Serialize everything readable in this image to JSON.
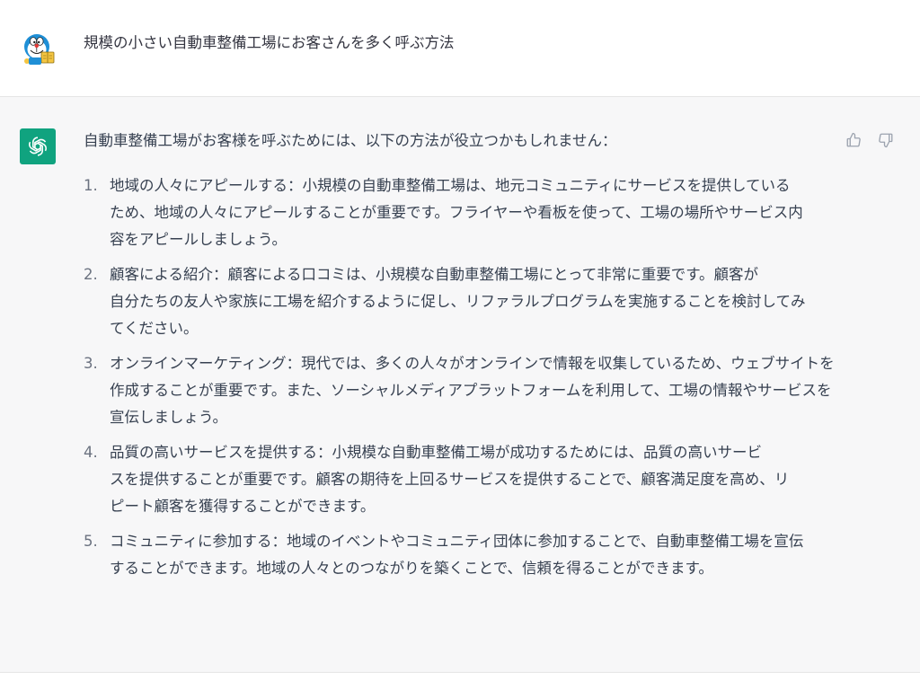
{
  "user_message": {
    "text": "規模の小さい自動車整備工場にお客さんを多く呼ぶ方法"
  },
  "assistant_message": {
    "intro": "自動車整備工場がお客様を呼ぶためには、以下の方法が役立つかもしれません：",
    "items": [
      {
        "number": "1.",
        "lines": [
          "地域の人々にアピールする：小規模の自動車整備工場は、地元コミュニティにサービスを提供している",
          "ため、地域の人々にアピールすることが重要です。フライヤーや看板を使って、工場の場所やサービス内",
          "容をアピールしましょう。"
        ]
      },
      {
        "number": "2.",
        "lines": [
          "顧客による紹介：顧客による口コミは、小規模な自動車整備工場にとって非常に重要です。顧客が",
          "自分たちの友人や家族に工場を紹介するように促し、リファラルプログラムを実施することを検討してみ",
          "てください。"
        ]
      },
      {
        "number": "3.",
        "lines": [
          "オンラインマーケティング：現代では、多くの人々がオンラインで情報を収集しているため、ウェブサイトを",
          "作成することが重要です。また、ソーシャルメディアプラットフォームを利用して、工場の情報やサービスを",
          "宣伝しましょう。"
        ]
      },
      {
        "number": "4.",
        "lines": [
          "品質の高いサービスを提供する：小規模な自動車整備工場が成功するためには、品質の高いサービ",
          "スを提供することが重要です。顧客の期待を上回るサービスを提供することで、顧客満足度を高め、リ",
          "ピート顧客を獲得することができます。"
        ]
      },
      {
        "number": "5.",
        "lines": [
          "コミュニティに参加する：地域のイベントやコミュニティ団体に参加することで、自動車整備工場を宣伝",
          "することができます。地域の人々とのつながりを築くことで、信頼を得ることができます。"
        ]
      }
    ]
  },
  "icons": {
    "user_avatar": "cartoon-character-avatar",
    "assistant_avatar": "assistant-logo-icon",
    "thumbs_up": "thumbs-up-icon",
    "thumbs_down": "thumbs-down-icon"
  },
  "colors": {
    "assistant_avatar_bg": "#10a37f",
    "assistant_row_bg": "#f7f7f8",
    "text": "#374151"
  }
}
